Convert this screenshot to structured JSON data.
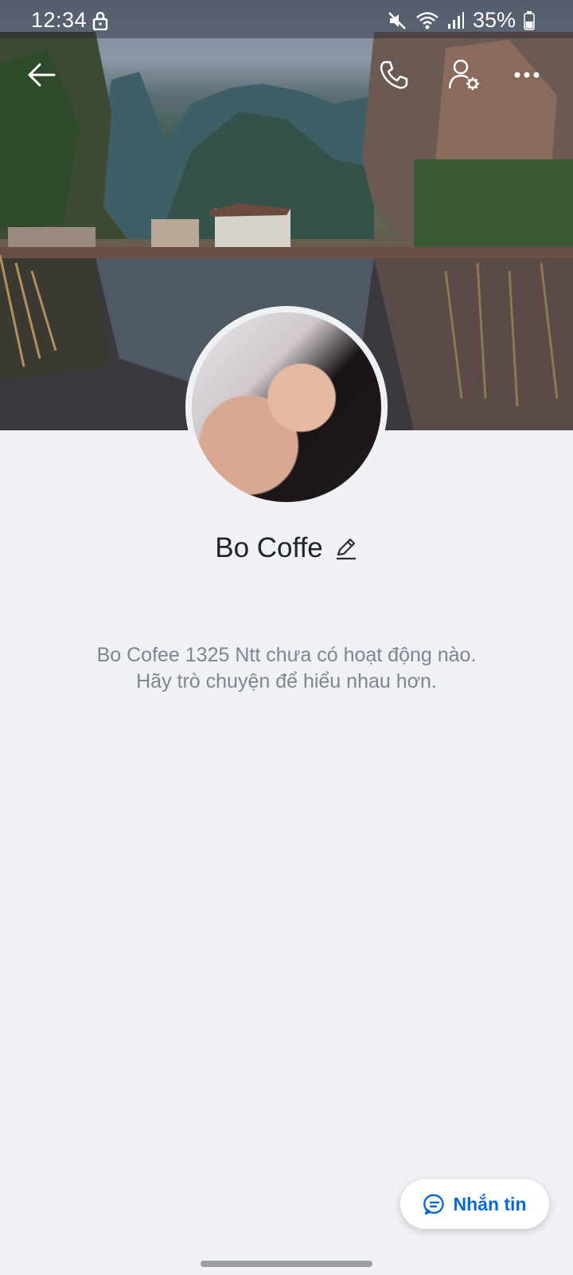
{
  "status_bar": {
    "time": "12:34",
    "battery": "35%"
  },
  "nav": {
    "back_icon": "arrow-left-icon",
    "call_icon": "phone-icon",
    "settings_icon": "user-settings-icon",
    "more_icon": "more-horizontal-icon"
  },
  "profile": {
    "name": "Bo Coffe",
    "empty_message_line1": "Bo Cofee 1325 Ntt chưa có hoạt động nào.",
    "empty_message_line2": "Hãy trò chuyện để hiểu nhau hơn."
  },
  "actions": {
    "message_label": "Nhắn tin"
  },
  "colors": {
    "accent": "#0a68d8",
    "background": "#f0f1f5"
  }
}
